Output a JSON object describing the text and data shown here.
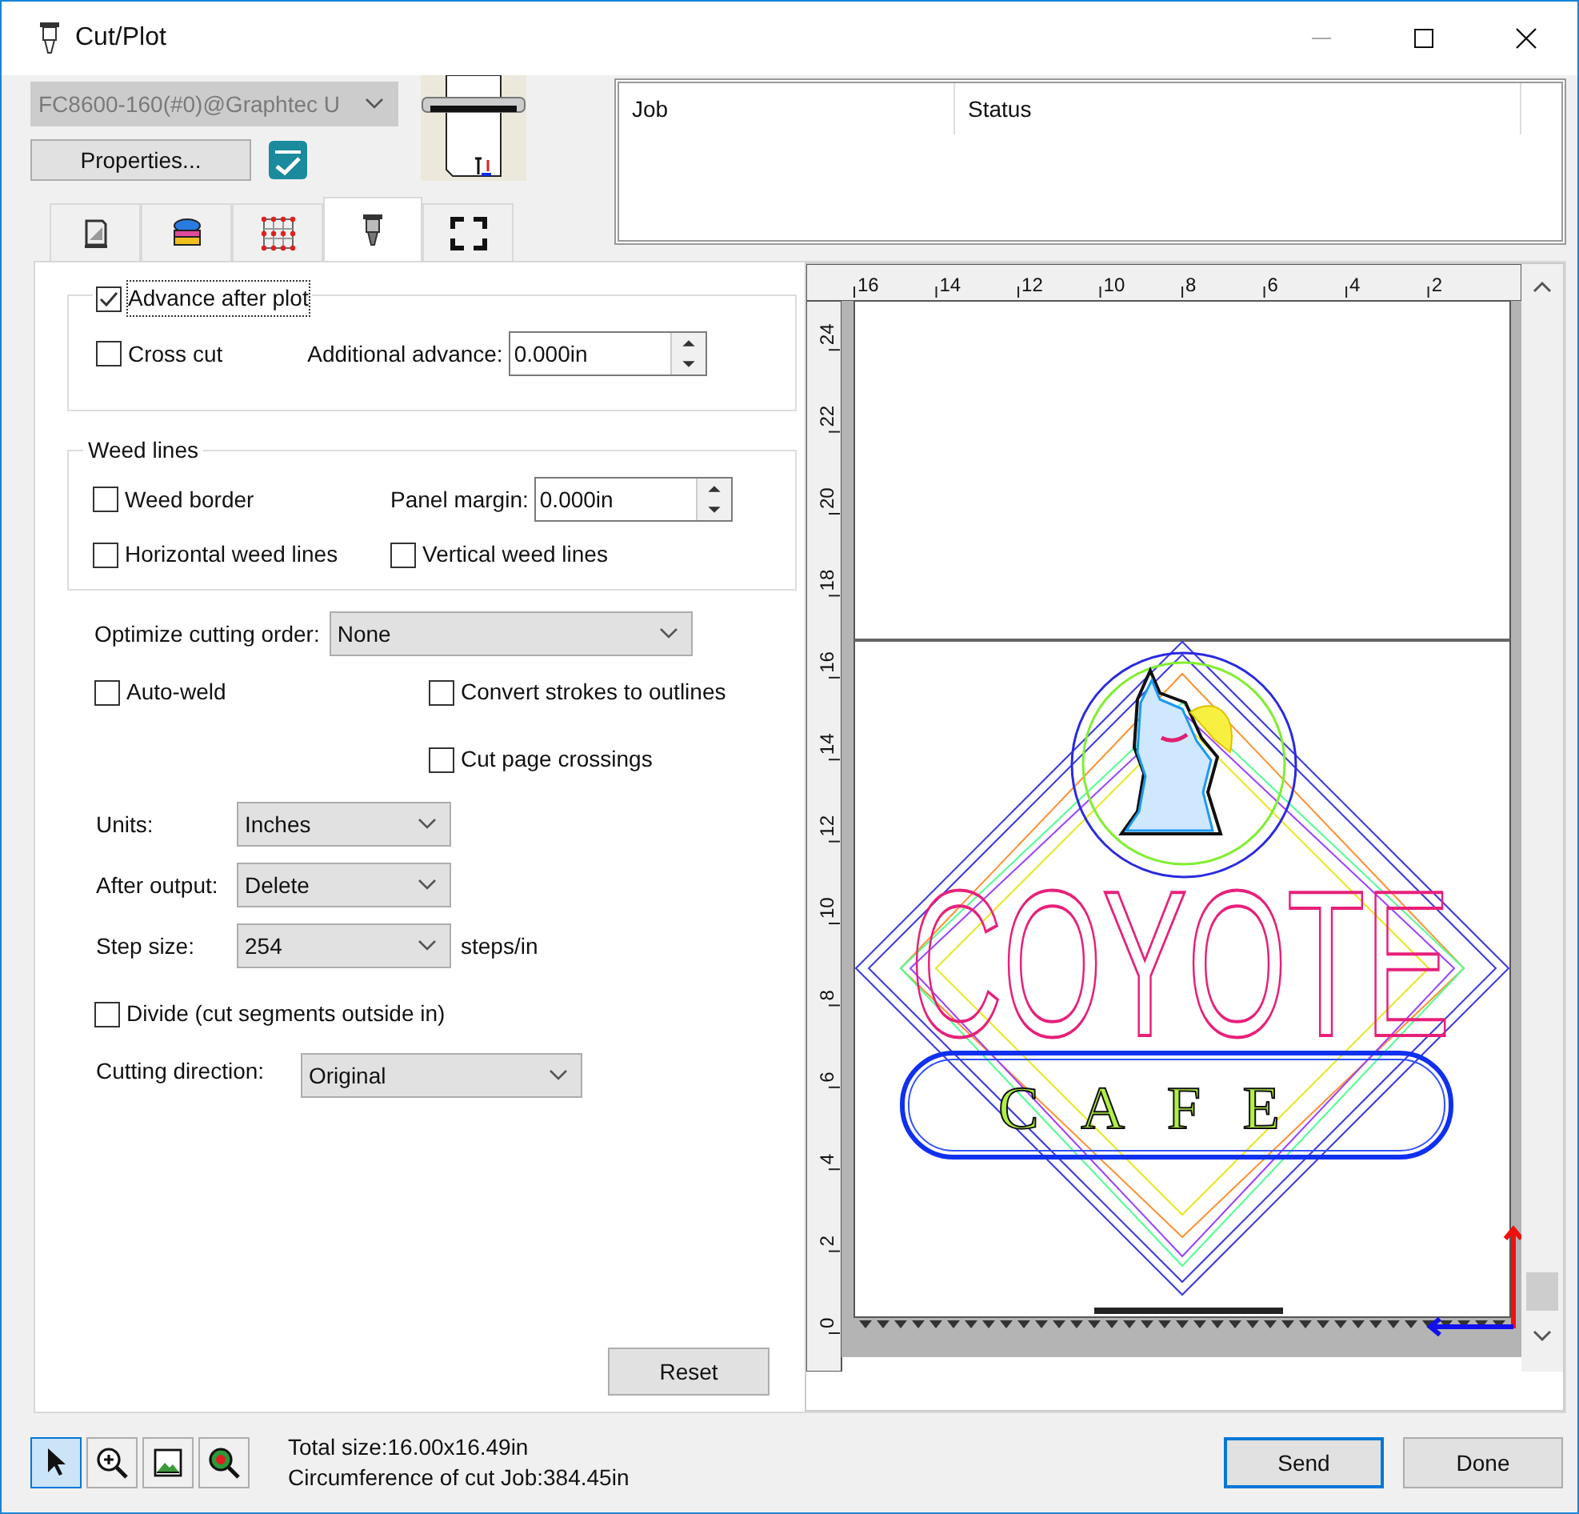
{
  "window": {
    "title": "Cut/Plot"
  },
  "device_select": {
    "value": "FC8600-160(#0)@Graphtec U",
    "disabled": true
  },
  "properties_button": "Properties...",
  "tabs": [
    {
      "kind": "document",
      "selected": false
    },
    {
      "kind": "layers",
      "selected": false
    },
    {
      "kind": "grid",
      "selected": false
    },
    {
      "kind": "cutter",
      "selected": true
    },
    {
      "kind": "frame",
      "selected": false
    }
  ],
  "job_table": {
    "columns": [
      "Job",
      "Status"
    ]
  },
  "advance_group": {
    "advance": {
      "label": "Advance after plot",
      "checked": true
    },
    "cross_cut": {
      "label": "Cross cut",
      "checked": false
    },
    "additional_advance": {
      "label": "Additional advance:",
      "value": "0.000in"
    }
  },
  "weed_lines": {
    "title": "Weed lines",
    "weed_border": {
      "label": "Weed border",
      "checked": false
    },
    "panel_margin": {
      "label": "Panel margin:",
      "value": "0.000in"
    },
    "horizontal": {
      "label": "Horizontal weed lines",
      "checked": false
    },
    "vertical": {
      "label": "Vertical weed lines",
      "checked": false
    }
  },
  "optimize": {
    "label": "Optimize cutting order:",
    "value": "None"
  },
  "auto_weld": {
    "label": "Auto-weld",
    "checked": false
  },
  "convert_strokes": {
    "label": "Convert strokes to outlines",
    "checked": false
  },
  "cut_page_crossings": {
    "label": "Cut page crossings",
    "checked": false
  },
  "units": {
    "label": "Units:",
    "value": "Inches"
  },
  "after_output": {
    "label": "After output:",
    "value": "Delete"
  },
  "step_size": {
    "label": "Step size:",
    "value": "254",
    "suffix": "steps/in"
  },
  "divide": {
    "label": "Divide (cut segments outside in)",
    "checked": false
  },
  "cutting_direction": {
    "label": "Cutting direction:",
    "value": "Original"
  },
  "reset_button": "Reset",
  "preview": {
    "x_ruler": [
      "16",
      "14",
      "12",
      "10",
      "8",
      "6",
      "4",
      "2"
    ],
    "y_ruler": [
      "24",
      "22",
      "20",
      "18",
      "16",
      "14",
      "12",
      "10",
      "8",
      "6",
      "4",
      "2",
      "0"
    ],
    "logo_title": "COYOTE",
    "logo_subtitle": "CAFE"
  },
  "tools": [
    {
      "kind": "pointer",
      "selected": true
    },
    {
      "kind": "zoom",
      "selected": false
    },
    {
      "kind": "picture",
      "selected": false
    },
    {
      "kind": "zoom-fit",
      "selected": false
    }
  ],
  "summary": [
    "Total size:16.00x16.49in",
    "Circumference of cut Job:384.45in"
  ],
  "buttons": [
    {
      "label": "Send",
      "default": true
    },
    {
      "label": "Done",
      "default": false
    }
  ]
}
